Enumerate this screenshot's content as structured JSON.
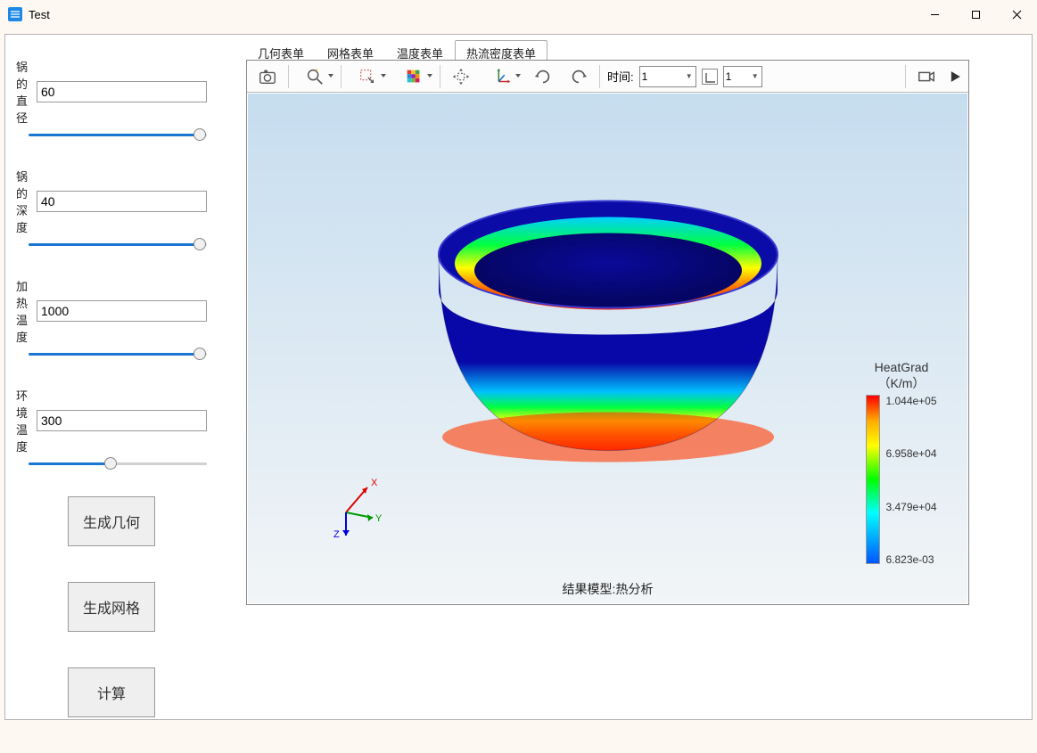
{
  "window": {
    "title": "Test"
  },
  "params": [
    {
      "label": "锅的直径",
      "value": "60",
      "pct": 96
    },
    {
      "label": "锅的深度",
      "value": "40",
      "pct": 96
    },
    {
      "label": "加热温度",
      "value": "1000",
      "pct": 96
    },
    {
      "label": "环境温度",
      "value": "300",
      "pct": 46
    }
  ],
  "actions": {
    "gen_geom": "生成几何",
    "gen_mesh": "生成网格",
    "compute": "计算"
  },
  "tabs": [
    {
      "label": "几何表单"
    },
    {
      "label": "网格表单"
    },
    {
      "label": "温度表单"
    },
    {
      "label": "热流密度表单",
      "active": true
    }
  ],
  "toolbar": {
    "time_label": "时间:",
    "time_value_1": "1",
    "time_value_2": "1"
  },
  "axes": {
    "x": "X",
    "y": "Y",
    "z": "Z"
  },
  "legend": {
    "title_line1": "HeatGrad",
    "title_line2": "（K/m）",
    "ticks": [
      "1.044e+05",
      "6.958e+04",
      "3.479e+04",
      "6.823e-03"
    ]
  },
  "caption": "结果模型:热分析"
}
